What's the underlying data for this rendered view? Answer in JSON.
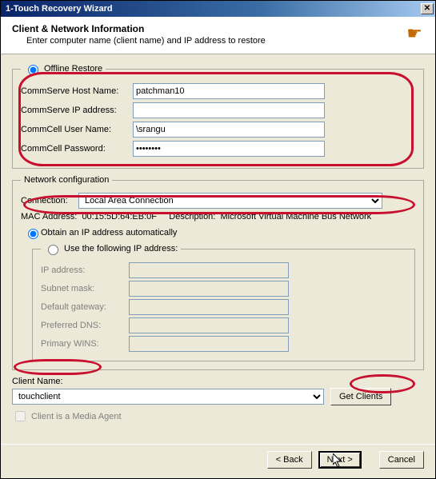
{
  "window": {
    "title": "1-Touch Recovery Wizard"
  },
  "header": {
    "title": "Client & Network Information",
    "subtitle": "Enter computer name (client name) and IP address to restore"
  },
  "offline": {
    "legend": "Offline Restore",
    "host_label": "CommServe Host Name:",
    "host_value": "patchman10",
    "ip_label": "CommServe IP address:",
    "ip_value": "",
    "user_label": "CommCell User Name:",
    "user_value": "\\srangu",
    "pass_label": "CommCell Password:",
    "pass_value": "••••••••"
  },
  "netcfg": {
    "legend": "Network configuration",
    "connection_label": "Connection:",
    "connection_value": "Local Area Connection",
    "mac_label": "MAC Address:",
    "mac_value": "00:15:5D:64:EB:0F",
    "desc_label": "Description:",
    "desc_value": "Microsoft Virtual Machine Bus Network",
    "auto_label": "Obtain an IP address automatically",
    "static_label": "Use the following IP address:",
    "ip_label": "IP address:",
    "subnet_label": "Subnet mask:",
    "gateway_label": "Default gateway:",
    "dns_label": "Preferred DNS:",
    "wins_label": "Primary WINS:"
  },
  "client": {
    "name_label": "Client Name:",
    "name_value": "touchclient",
    "get_clients": "Get Clients",
    "media_agent_label": "Client is a Media Agent"
  },
  "footer": {
    "back": "< Back",
    "next": "Next >",
    "cancel": "Cancel"
  }
}
